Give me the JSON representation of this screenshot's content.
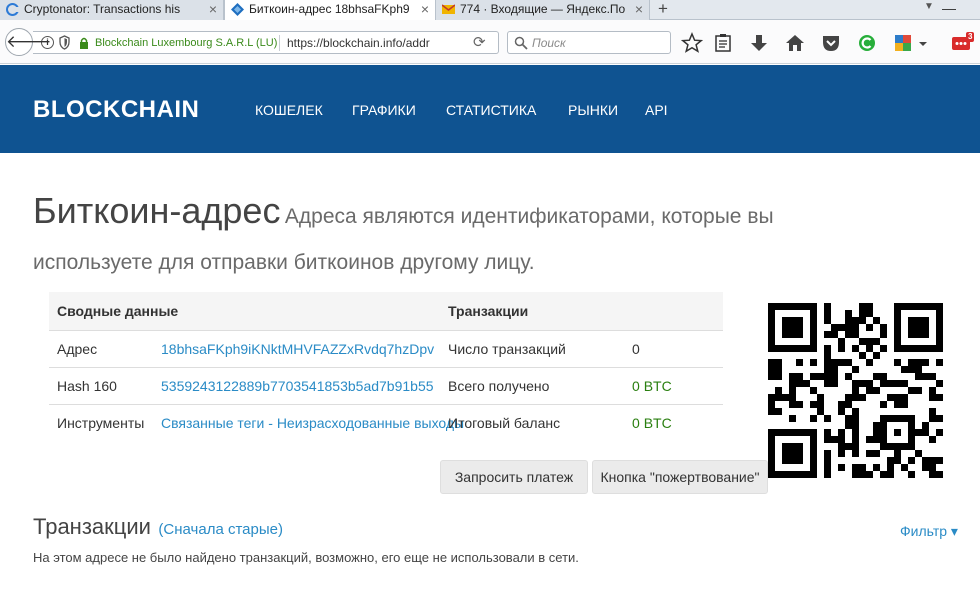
{
  "browser": {
    "tabs": [
      {
        "title": "Cryptonator: Transactions his",
        "close": "×"
      },
      {
        "title": "Биткоин-адрес 18bhsaFKph9",
        "close": "×"
      },
      {
        "title": "774 · Входящие — Яндекс.По",
        "close": "×"
      }
    ],
    "new_tab": "+",
    "minimize": "—",
    "url_owner": "Blockchain Luxembourg S.A.R.L (LU)",
    "url": "https://blockchain.info/addr",
    "search_placeholder": "Поиск",
    "badge": "3",
    "colors": {
      "https_green": "#3a8a1a"
    }
  },
  "site": {
    "logo": "BLOCKCHAIN",
    "nav": [
      "КОШЕЛЕК",
      "ГРАФИКИ",
      "СТАТИСТИКА",
      "РЫНКИ",
      "API"
    ],
    "colors": {
      "header_bg": "#0f5391",
      "link": "#2a8bc6",
      "green": "#2a7f10"
    }
  },
  "page": {
    "title": "Биткоин-адрес",
    "subtitle": "Адреса являются идентификаторами, которые вы используете для отправки биткоинов другому лицу."
  },
  "summary": {
    "header_left": "Сводные данные",
    "header_right": "Транзакции",
    "rows": [
      {
        "label": "Адрес",
        "value": "18bhsaFKph9iKNktMHVFAZZxRvdq7hzDpv",
        "tx_label": "Число транзакций",
        "tx_value": "0"
      },
      {
        "label": "Hash 160",
        "value": "5359243122889b7703541853b5ad7b91b55",
        "tx_label": "Всего получено",
        "tx_value": "0 BTC"
      },
      {
        "label": "Инструменты",
        "value_a": "Связанные теги",
        "value_sep": " - ",
        "value_b": "Неизрасходованные выходы",
        "tx_label": "Итоговый баланс",
        "tx_value": "0 BTC"
      }
    ]
  },
  "buttons": {
    "request_payment": "Запросить платеж",
    "donate_button": "Кнопка \"пожертвование\""
  },
  "transactions": {
    "title": "Транзакции",
    "order": "(Сначала старые)",
    "filter": "Фильтр ▾",
    "empty": "На этом адресе не было найдено транзакций, возможно, его еще не использовали в сети."
  }
}
